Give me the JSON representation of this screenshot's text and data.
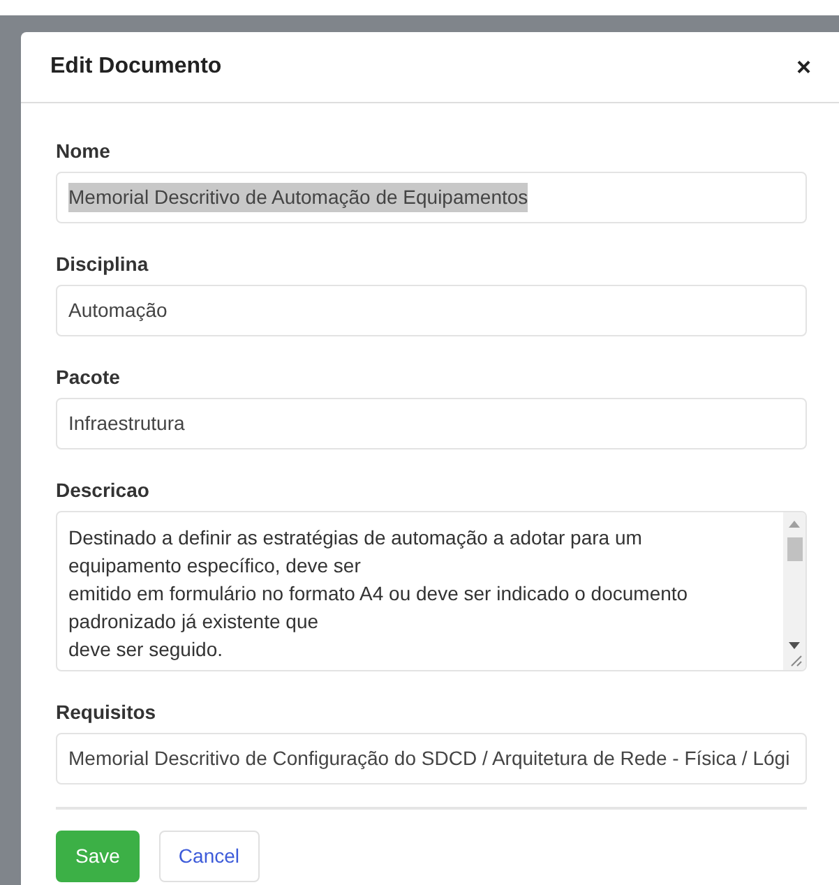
{
  "dialog": {
    "title": "Edit Documento",
    "close": "×"
  },
  "fields": [
    {
      "kind": "input",
      "label": "Nome",
      "value": "Memorial Descritivo de Automação de Equipamentos",
      "highlighted": true
    },
    {
      "kind": "input",
      "label": "Disciplina",
      "value": "Automação",
      "highlighted": false
    },
    {
      "kind": "input",
      "label": "Pacote",
      "value": "Infraestrutura",
      "highlighted": false
    },
    {
      "kind": "textarea",
      "label": "Descricao",
      "lines": [
        "Destinado a definir as estratégias de automação a adotar para um",
        "equipamento específico, deve ser",
        "emitido em formulário no formato A4 ou deve ser indicado o documento",
        "padronizado já existente que",
        "deve ser seguido."
      ]
    },
    {
      "kind": "input",
      "label": "Requisitos",
      "value": "Memorial Descritivo de Configuração do SDCD / Arquitetura de Rede - Física / Lógi",
      "highlighted": false
    }
  ],
  "buttons": [
    {
      "kind": "primary",
      "label": "Save"
    },
    {
      "kind": "secondary",
      "label": "Cancel"
    }
  ]
}
